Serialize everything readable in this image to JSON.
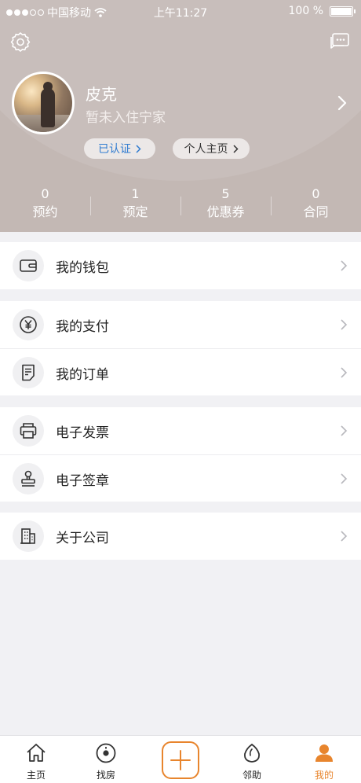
{
  "status_bar": {
    "carrier": "中国移动",
    "time": "上午11:27",
    "battery": "100 %"
  },
  "profile": {
    "name": "皮克",
    "status": "暂未入住宁家",
    "verified_label": "已认证",
    "homepage_label": "个人主页"
  },
  "stats": [
    {
      "value": "0",
      "label": "预约"
    },
    {
      "value": "1",
      "label": "预定"
    },
    {
      "value": "5",
      "label": "优惠券"
    },
    {
      "value": "0",
      "label": "合同"
    }
  ],
  "menu": {
    "wallet": "我的钱包",
    "payment": "我的支付",
    "orders": "我的订单",
    "invoice": "电子发票",
    "seal": "电子签章",
    "about": "关于公司"
  },
  "tabs": [
    {
      "label": "主页",
      "icon": "home-icon"
    },
    {
      "label": "找房",
      "icon": "find-house-icon"
    },
    {
      "label": "",
      "icon": "plus-icon"
    },
    {
      "label": "邻助",
      "icon": "neighbor-help-icon"
    },
    {
      "label": "我的",
      "icon": "profile-icon"
    }
  ],
  "colors": {
    "header": "#c3b8b4",
    "accent": "#e8852d",
    "verified": "#2f7bd0"
  }
}
